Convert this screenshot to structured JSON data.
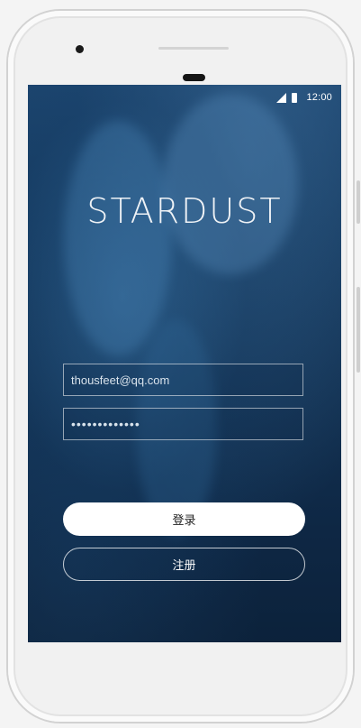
{
  "status_bar": {
    "time": "12:00",
    "signal_icon": "signal-icon",
    "battery_icon": "battery-icon"
  },
  "app": {
    "logo_text": "STARDUST"
  },
  "login_form": {
    "email_value": "thousfeet@qq.com",
    "password_value": "•••••••••••••",
    "login_label": "登录",
    "register_label": "注册"
  },
  "colors": {
    "background_top": "#1d4670",
    "background_bottom": "#0c223b",
    "button_primary": "#ffffff"
  }
}
